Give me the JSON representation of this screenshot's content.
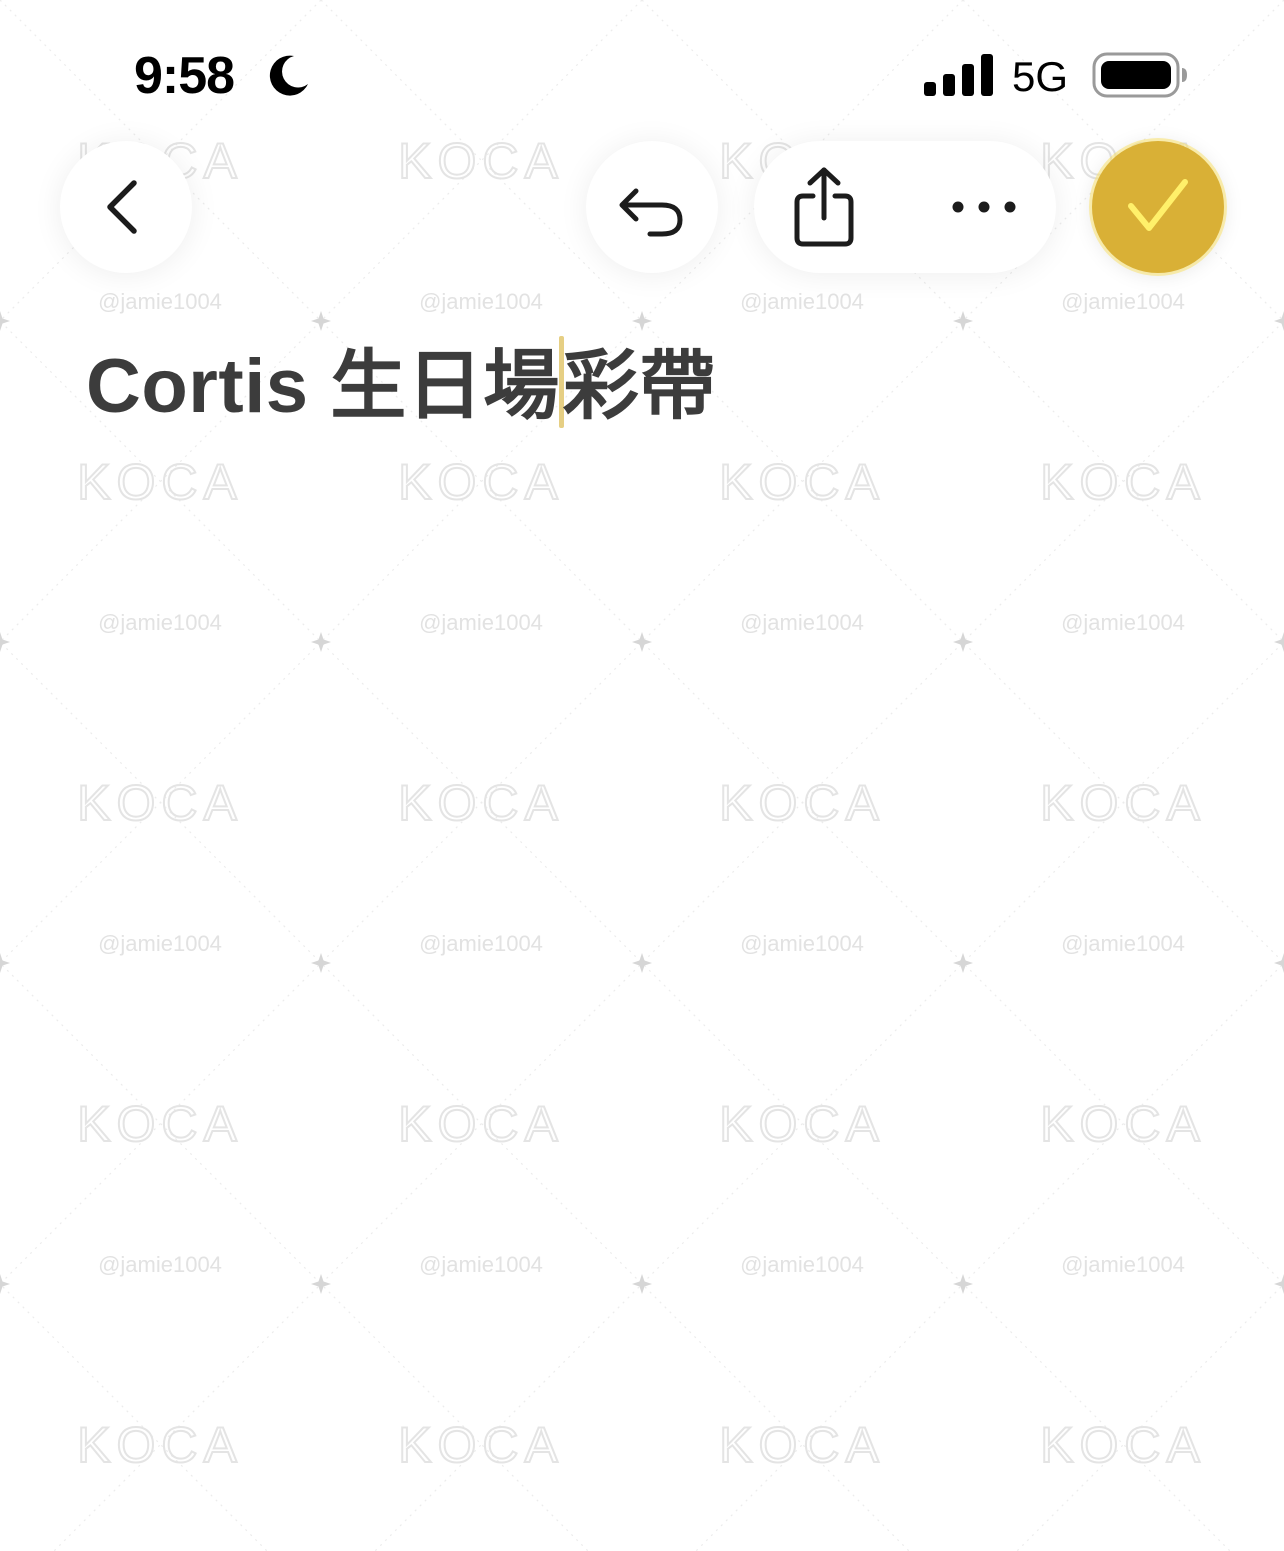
{
  "status_bar": {
    "time": "9:58",
    "focus_icon": "moon-icon",
    "signal_icon": "cellular-signal-icon",
    "network": "5G",
    "battery_icon": "battery-icon"
  },
  "toolbar": {
    "back_icon": "chevron-left-icon",
    "undo_icon": "undo-icon",
    "share_icon": "share-icon",
    "more_icon": "ellipsis-icon",
    "done_icon": "checkmark-icon"
  },
  "note": {
    "title_before_cursor": "Cortis 生日場",
    "title_after_cursor": "彩帶"
  },
  "watermark": {
    "brand": "KOCA",
    "handle": "@jamie1004"
  },
  "colors": {
    "accent": "#d9b036",
    "checkmark": "#fff06a",
    "title_text": "#3c3c3c",
    "cursor": "#e6cf84"
  }
}
